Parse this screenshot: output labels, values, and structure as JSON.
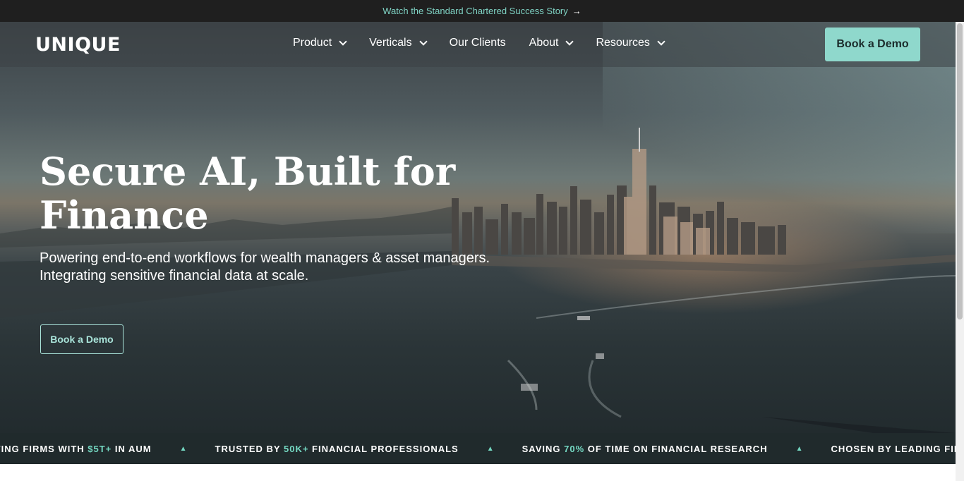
{
  "announcement": {
    "text": "Watch the Standard Chartered Success Story",
    "arrow": "→"
  },
  "nav": {
    "logo": "UNIQUE",
    "items": [
      {
        "label": "Product",
        "has_dropdown": true
      },
      {
        "label": "Verticals",
        "has_dropdown": true
      },
      {
        "label": "Our Clients",
        "has_dropdown": false
      },
      {
        "label": "About",
        "has_dropdown": true
      },
      {
        "label": "Resources",
        "has_dropdown": true
      }
    ],
    "cta": "Book a Demo"
  },
  "hero": {
    "headline": "Secure AI, Built for Finance",
    "subheadline": "Powering end-to-end workflows for wealth managers & asset managers. Integrating sensitive financial data at scale.",
    "cta": "Book a Demo"
  },
  "ticker": [
    {
      "pre": "VING FIRMS WITH ",
      "hl": "$5T+",
      "post": " IN AUM"
    },
    {
      "pre": "TRUSTED BY ",
      "hl": "50K+",
      "post": " FINANCIAL PROFESSIONALS"
    },
    {
      "pre": "SAVING ",
      "hl": "70%",
      "post": " OF TIME ON FINANCIAL RESEARCH"
    },
    {
      "pre": "CHOSEN BY LEADING FINANCIAL IN",
      "hl": "",
      "post": ""
    }
  ],
  "colors": {
    "accent": "#8fd8cc",
    "ticker_highlight": "#74d8c2",
    "announcement_bg": "#1f1f1f"
  }
}
